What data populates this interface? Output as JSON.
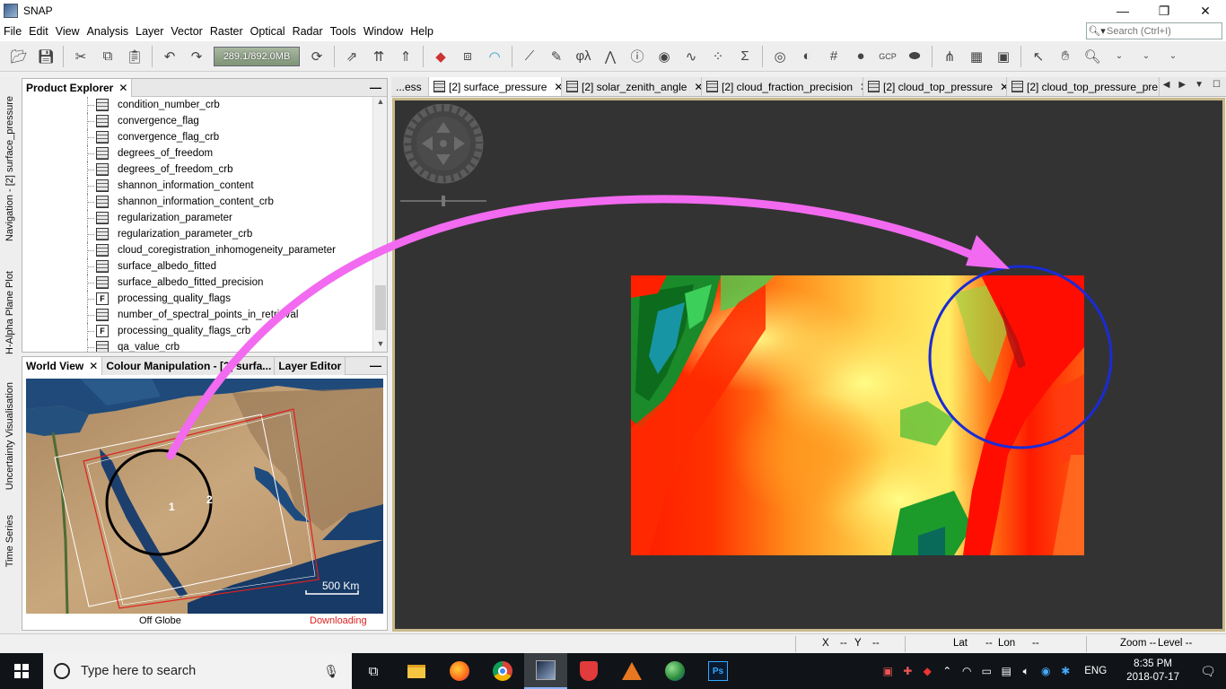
{
  "window": {
    "title": "SNAP",
    "minimize": "—",
    "restore": "❐",
    "close": "✕"
  },
  "menu": [
    "File",
    "Edit",
    "View",
    "Analysis",
    "Layer",
    "Vector",
    "Raster",
    "Optical",
    "Radar",
    "Tools",
    "Window",
    "Help"
  ],
  "search": {
    "placeholder": "Search (Ctrl+I)"
  },
  "toolbar": {
    "memory": "289.1/892.0MB"
  },
  "sidetabs": [
    "Navigation - [2] surface_pressure",
    "H-Alpha Plane Plot",
    "Uncertainty Visualisation",
    "Time Series"
  ],
  "product_explorer": {
    "title": "Product Explorer",
    "close": "✕",
    "minimize": "—",
    "items": [
      {
        "label": "condition_number_crb",
        "icon": "band-icon"
      },
      {
        "label": "convergence_flag",
        "icon": "band-icon"
      },
      {
        "label": "convergence_flag_crb",
        "icon": "band-icon"
      },
      {
        "label": "degrees_of_freedom",
        "icon": "band-icon"
      },
      {
        "label": "degrees_of_freedom_crb",
        "icon": "band-icon"
      },
      {
        "label": "shannon_information_content",
        "icon": "band-icon"
      },
      {
        "label": "shannon_information_content_crb",
        "icon": "band-icon"
      },
      {
        "label": "regularization_parameter",
        "icon": "band-icon"
      },
      {
        "label": "regularization_parameter_crb",
        "icon": "band-icon"
      },
      {
        "label": "cloud_coregistration_inhomogeneity_parameter",
        "icon": "band-icon"
      },
      {
        "label": "surface_albedo_fitted",
        "icon": "band-icon"
      },
      {
        "label": "surface_albedo_fitted_precision",
        "icon": "band-icon"
      },
      {
        "label": "processing_quality_flags",
        "icon": "flag-icon"
      },
      {
        "label": "number_of_spectral_points_in_retrieval",
        "icon": "band-icon"
      },
      {
        "label": "processing_quality_flags_crb",
        "icon": "flag-icon"
      },
      {
        "label": "qa_value_crb",
        "icon": "band-icon"
      }
    ]
  },
  "world_panel": {
    "tabs": [
      {
        "label": "World View",
        "close": "✕"
      },
      {
        "label": "Colour Manipulation - [2] surfa..."
      },
      {
        "label": "Layer Editor"
      }
    ],
    "minimize": "—",
    "marker1": "1",
    "marker2": "2",
    "scale": "500 Km",
    "status_left": "Off Globe",
    "status_right": "Downloading"
  },
  "doc_tabs": {
    "overflow": "...ess",
    "tabs": [
      {
        "label": "[2] surface_pressure",
        "close": "✕",
        "active": true
      },
      {
        "label": "[2] solar_zenith_angle",
        "close": "✕"
      },
      {
        "label": "[2] cloud_fraction_precision",
        "close": "✕"
      },
      {
        "label": "[2] cloud_top_pressure",
        "close": "✕"
      },
      {
        "label": "[2] cloud_top_pressure_pre...",
        "close": "✕"
      }
    ],
    "nav_prev": "◀",
    "nav_next": "▶",
    "nav_menu": "▼",
    "nav_max": "☐"
  },
  "statusbar": {
    "x": "X",
    "x_val": "--",
    "y": "Y",
    "y_val": "--",
    "lat": "Lat",
    "lat_val": "--",
    "lon": "Lon",
    "lon_val": "--",
    "zoom": "Zoom --",
    "level": "Level --"
  },
  "taskbar": {
    "search": "Type here to search",
    "lang": "ENG",
    "time": "8:35 PM",
    "date": "2018-07-17"
  },
  "colors": {
    "accent_pink": "#f26af0",
    "circle_blue": "#1a2bd6",
    "downloading": "#dd2222",
    "image_frame": "#c8b98a"
  }
}
